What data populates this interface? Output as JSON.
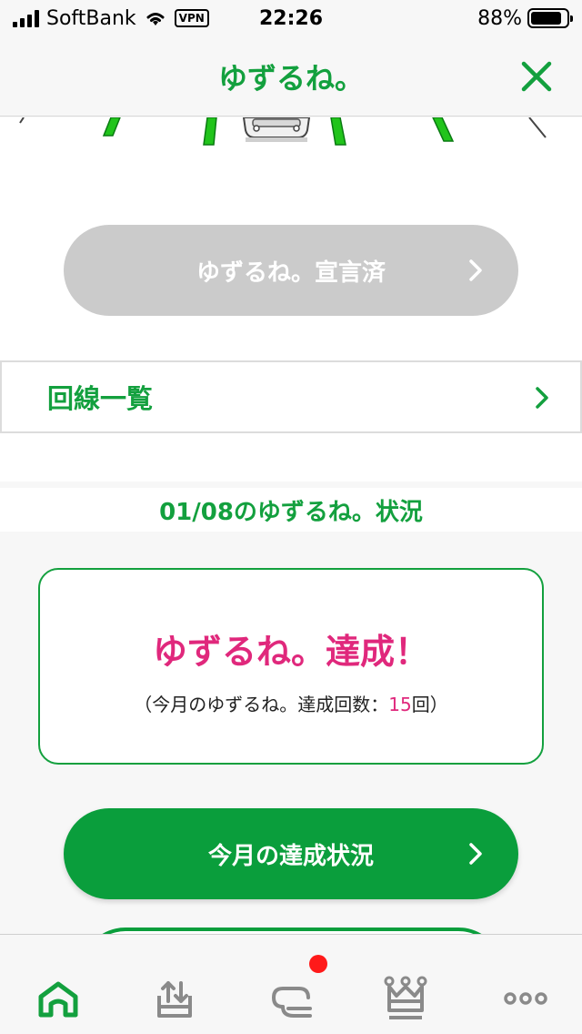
{
  "status_bar": {
    "carrier": "SoftBank",
    "vpn": "VPN",
    "time": "22:26",
    "battery": "88%",
    "battery_level": 0.88
  },
  "nav": {
    "title": "ゆずるね。",
    "close_icon": "close-icon"
  },
  "hero": {
    "declared_button_label": "ゆずるね。宣言済"
  },
  "lines_row": {
    "label": "回線一覧"
  },
  "status": {
    "title": "01/08のゆずるね。状況",
    "result_main": "ゆずるね。達成！",
    "result_sub_prefix": "（今月のゆずるね。達成回数：",
    "result_count": "15",
    "result_sub_suffix": "回）"
  },
  "month_button": {
    "label": "今月の達成状況"
  },
  "tab_bar": {
    "items": [
      "home-icon",
      "upload-icon",
      "chat-icon",
      "crown-icon",
      "more-icon"
    ],
    "active_color": "#13a03e",
    "inactive_color": "#8a8a8a"
  },
  "colors": {
    "brand_green": "#13a03e",
    "accent_pink": "#e0287c",
    "disabled_gray": "#cbcbcb"
  }
}
